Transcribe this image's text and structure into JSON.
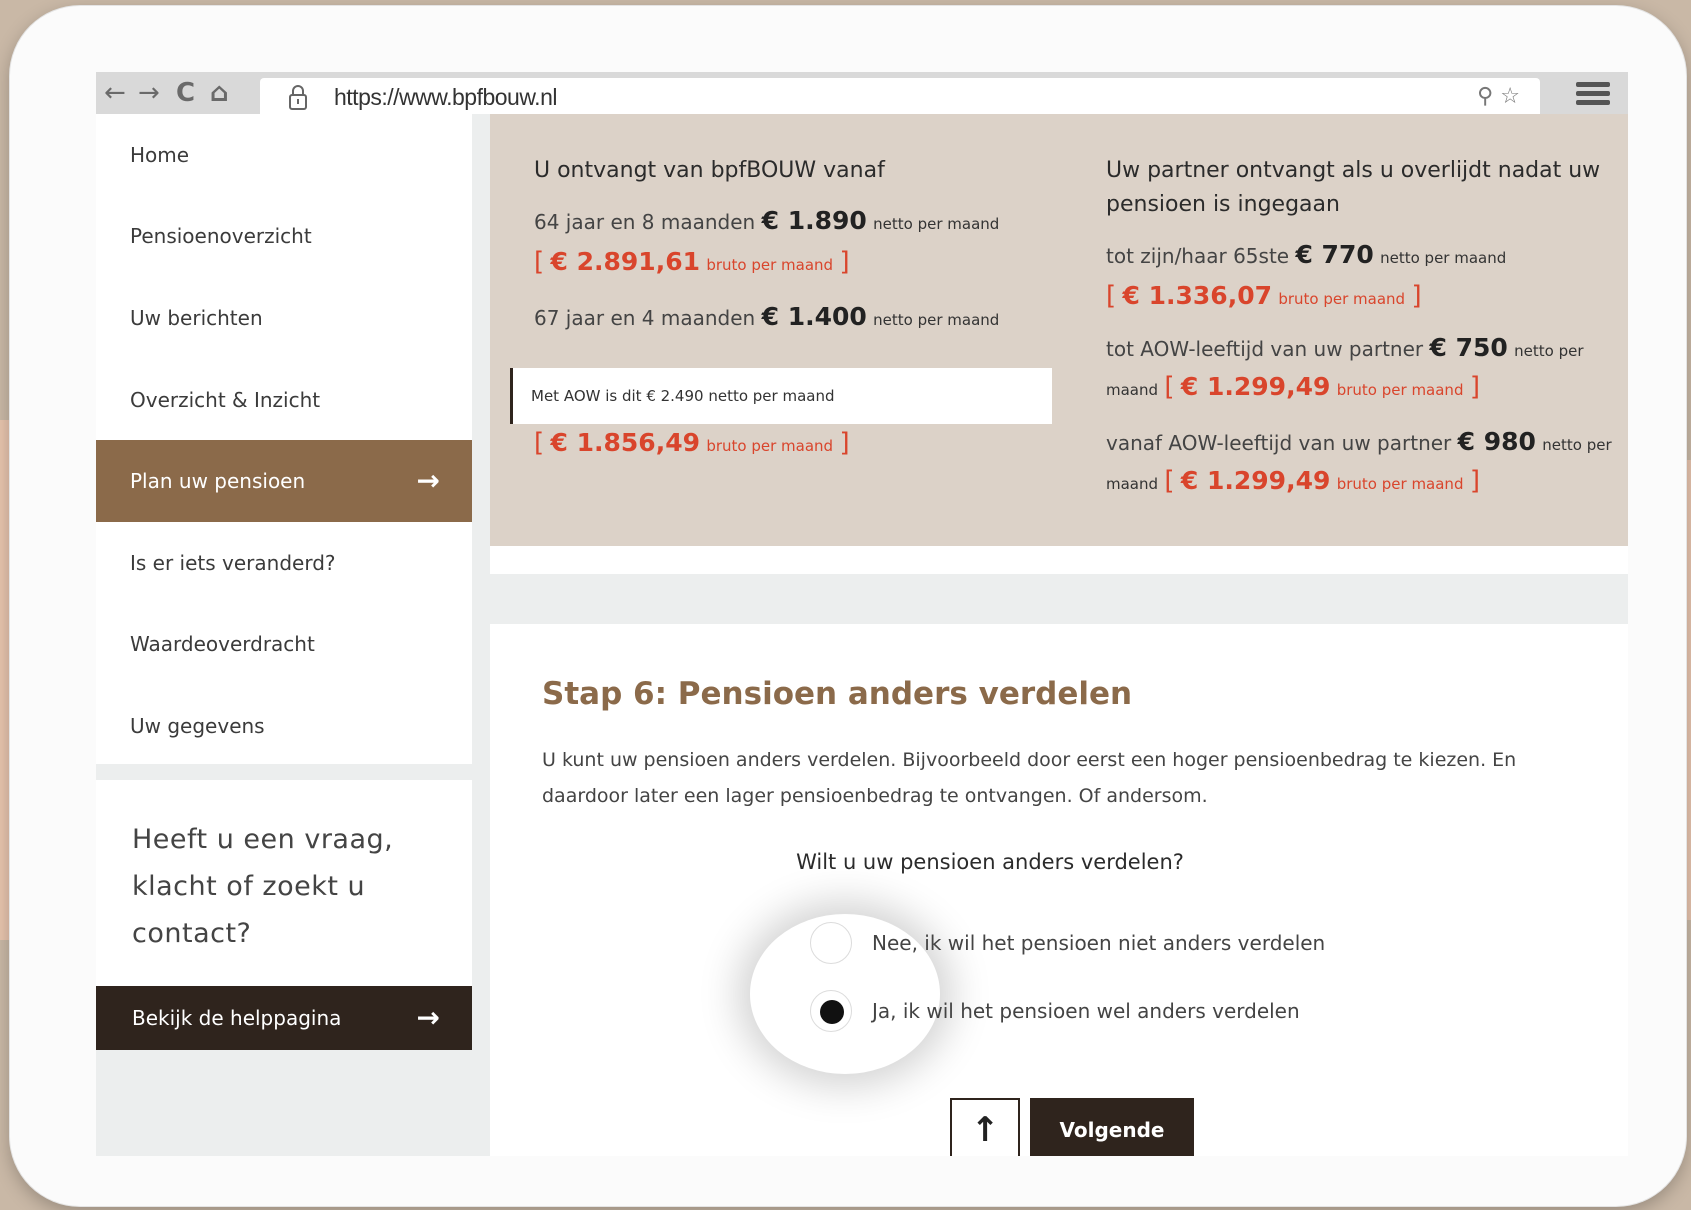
{
  "browser": {
    "url": "https://www.bpfbouw.nl",
    "back_glyph": "←",
    "forward_glyph": "→",
    "reload_glyph": "C",
    "home_glyph": "⌂",
    "search_glyph": "⚲",
    "star_glyph": "☆"
  },
  "sidebar": {
    "items": [
      {
        "label": "Home"
      },
      {
        "label": "Pensioenoverzicht"
      },
      {
        "label": "Uw berichten"
      },
      {
        "label": "Overzicht & Inzicht"
      },
      {
        "label": "Plan uw pensioen"
      },
      {
        "label": "Is er iets veranderd?"
      },
      {
        "label": "Waardeoverdracht"
      },
      {
        "label": "Uw gegevens"
      }
    ],
    "active_index": 4,
    "arrow_glyph": "→"
  },
  "help": {
    "text": "Heeft u een vraag, klacht of zoekt u contact?",
    "button_label": "Bekijk de helppagina",
    "arrow_glyph": "→"
  },
  "summary": {
    "left_title": "U ontvangt van bpfBOUW vanaf",
    "left": {
      "row1_label": "64 jaar en 8 maanden",
      "row1_amount": "€ 1.890",
      "row1_unit": "netto per maand",
      "row1_gross": "€ 2.891,61",
      "row1_gross_unit": "bruto per maand",
      "row2_label": "67 jaar en 4 maanden",
      "row2_amount": "€ 1.400",
      "row2_unit": "netto per maand",
      "aow_text": "Met AOW is dit  € 2.490 netto per maand",
      "row2_gross": "€ 1.856,49",
      "row2_gross_unit": "bruto per maand"
    },
    "right_title": "Uw partner ontvangt als u overlijdt nadat uw pensioen is ingegaan",
    "right": {
      "row1_label": "tot zijn/haar 65ste",
      "row1_amount": "€ 770",
      "row1_unit": "netto per maand",
      "row1_gross": "€ 1.336,07",
      "row1_gross_unit": "bruto per maand",
      "row2_label": "tot AOW-leeftijd van uw partner",
      "row2_amount": "€ 750",
      "row2_unit_a": "netto per",
      "row2_unit_b": "maand",
      "row2_gross": "€ 1.299,49",
      "row2_gross_unit": "bruto per maand",
      "row3_label": "vanaf AOW-leeftijd van uw partner",
      "row3_amount": "€ 980",
      "row3_unit_a": "netto per",
      "row3_unit_b": "maand",
      "row3_gross": "€ 1.299,49",
      "row3_gross_unit": "bruto per maand"
    },
    "bracket_open": "[",
    "bracket_close": "]"
  },
  "step": {
    "title": "Stap 6: Pensioen anders verdelen",
    "description": "U kunt uw pensioen anders verdelen. Bijvoorbeeld door eerst een hoger pensioenbedrag te kiezen. En daardoor later een lager pensioenbedrag te ontvangen. Of andersom.",
    "question": "Wilt u uw pensioen anders verdelen?",
    "options": [
      {
        "label": "Nee, ik wil het pensioen niet anders verdelen",
        "checked": false
      },
      {
        "label": "Ja, ik wil het pensioen wel anders verdelen",
        "checked": true
      }
    ],
    "up_glyph": "↑",
    "next_label": "Volgende"
  }
}
